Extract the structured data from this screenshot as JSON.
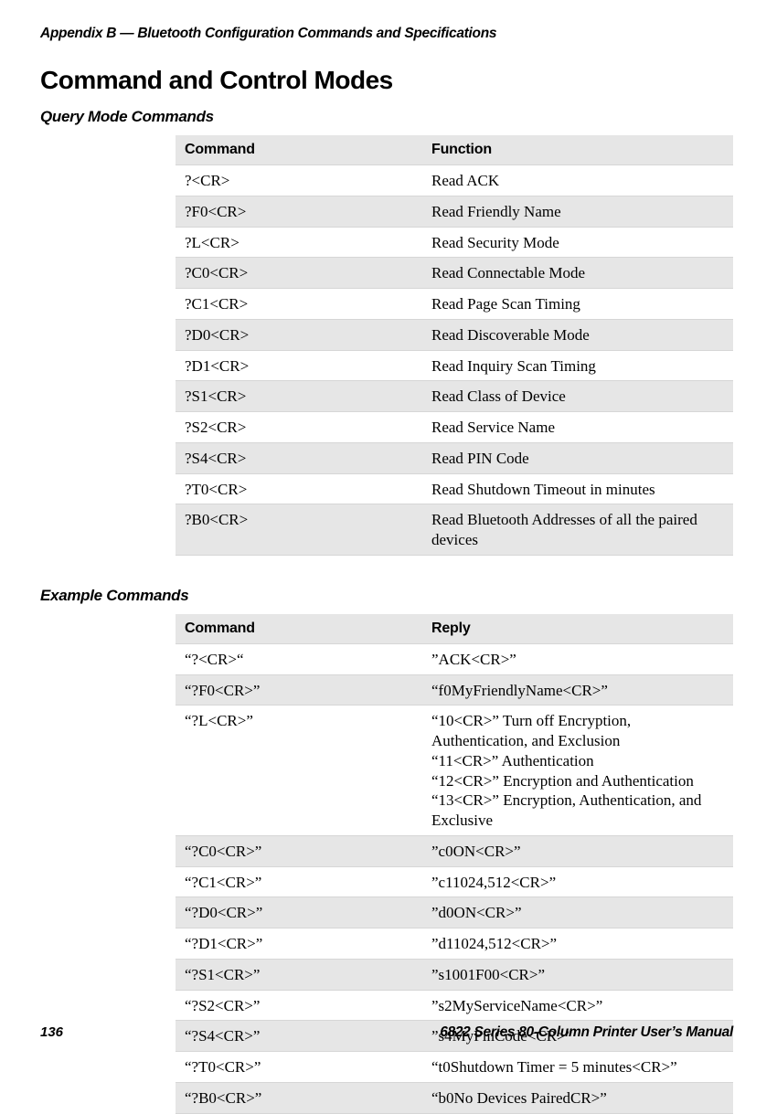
{
  "header": "Appendix B — Bluetooth Configuration Commands and Specifications",
  "title": "Command and Control Modes",
  "sections": {
    "query": {
      "heading": "Query Mode Commands",
      "th1": "Command",
      "th2": "Function",
      "rows": [
        {
          "c": "?<CR>",
          "f": "Read ACK"
        },
        {
          "c": "?F0<CR>",
          "f": "Read Friendly Name"
        },
        {
          "c": "?L<CR>",
          "f": "Read Security Mode"
        },
        {
          "c": "?C0<CR>",
          "f": "Read Connectable Mode"
        },
        {
          "c": "?C1<CR>",
          "f": "Read Page Scan Timing"
        },
        {
          "c": "?D0<CR>",
          "f": "Read Discoverable Mode"
        },
        {
          "c": "?D1<CR>",
          "f": "Read Inquiry Scan Timing"
        },
        {
          "c": "?S1<CR>",
          "f": "Read Class of Device"
        },
        {
          "c": "?S2<CR>",
          "f": "Read Service Name"
        },
        {
          "c": "?S4<CR>",
          "f": "Read PIN Code"
        },
        {
          "c": "?T0<CR>",
          "f": "Read Shutdown Timeout in minutes"
        },
        {
          "c": "?B0<CR>",
          "f": "Read Bluetooth Addresses of all the paired devices"
        }
      ]
    },
    "example": {
      "heading": "Example Commands",
      "th1": "Command",
      "th2": "Reply",
      "rows": [
        {
          "c": "“?<CR>“",
          "r": "”ACK<CR>”"
        },
        {
          "c": "“?F0<CR>”",
          "r": "“f0MyFriendlyName<CR>”"
        },
        {
          "c": "“?L<CR>”",
          "r": "“10<CR>” Turn off Encryption, Authentication, and Exclusion\n“11<CR>” Authentication\n“12<CR>” Encryption and Authentication\n“13<CR>” Encryption, Authentication, and Exclusive"
        },
        {
          "c": "“?C0<CR>”",
          "r": "”c0ON<CR>”"
        },
        {
          "c": "“?C1<CR>”",
          "r": "”c11024,512<CR>”"
        },
        {
          "c": "“?D0<CR>”",
          "r": "”d0ON<CR>”"
        },
        {
          "c": "“?D1<CR>”",
          "r": "”d11024,512<CR>”"
        },
        {
          "c": "“?S1<CR>”",
          "r": "”s1001F00<CR>”"
        },
        {
          "c": "“?S2<CR>”",
          "r": "”s2MyServiceName<CR>”"
        },
        {
          "c": "“?S4<CR>”",
          "r": "”s4MyPinCode<CR>”"
        },
        {
          "c": "“?T0<CR>”",
          "r": "“t0Shutdown Timer = 5 minutes<CR>”"
        },
        {
          "c": "“?B0<CR>”",
          "r": "“b0No Devices PairedCR>”"
        }
      ]
    }
  },
  "footer": {
    "page": "136",
    "doc": "6822 Series 80-Column Printer User’s Manual"
  }
}
